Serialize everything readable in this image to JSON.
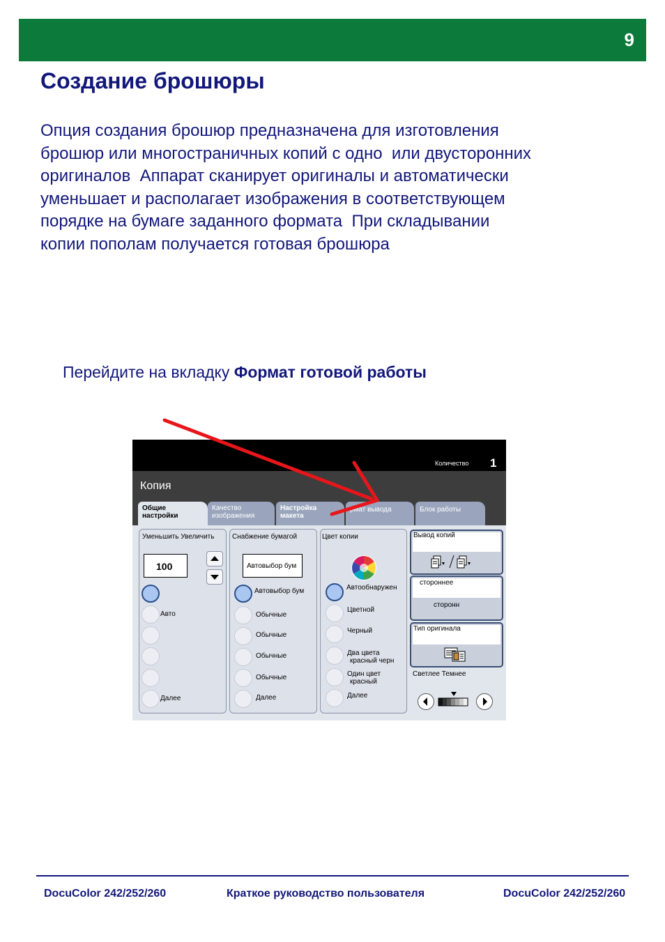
{
  "page": {
    "number": "9"
  },
  "title": "Создание брошюры",
  "intro_lines": [
    "Опция создания брошюр предназначена для изготовления",
    "брошюр или многостраничных копий с одно  или двусторонних",
    "оригиналов  Аппарат сканирует оригиналы и автоматически",
    "уменьшает и располагает изображения в соответствующем",
    "порядке на бумаге заданного формата  При складывании",
    "копии пополам получается готовая брошюра"
  ],
  "instruction": {
    "prefix": "Перейдите на вкладку ",
    "target": "Формат готовой работы"
  },
  "screen": {
    "quantity_label": "Количество",
    "quantity_value": "1",
    "title": "Копия",
    "tabs": [
      {
        "line1": "Общие",
        "line2": "настройки"
      },
      {
        "line1": "Качество",
        "line2": "изображения"
      },
      {
        "line1": "Настройка",
        "line2": "макета"
      },
      {
        "line1": "рмат вывода",
        "line2": ""
      },
      {
        "line1": "Блок работы",
        "line2": ""
      }
    ],
    "reduce_panel": {
      "label": "Уменьшить Увеличить",
      "value": "100",
      "options": [
        "Авто",
        "Далее"
      ]
    },
    "paper_panel": {
      "label": "Снабжение бумагой",
      "field": "Автовыбор бум",
      "options": [
        "Автовыбор бум",
        "Обычные",
        "Обычные",
        "Обычные",
        "Обычные",
        "Далее"
      ]
    },
    "color_panel": {
      "label": "Цвет копии",
      "options": [
        "Автообнаружен",
        "Цветной",
        "Черный",
        "Два цвета",
        "красный черн",
        "Один цвет",
        "красный",
        "Далее"
      ]
    },
    "output_panel": {
      "label": "Вывод копий"
    },
    "sides_panel": {
      "line1": "стороннее",
      "line2": "сторонн"
    },
    "original_panel": {
      "label": "Тип оригинала"
    },
    "density": {
      "label": "Светлее Темнее"
    }
  },
  "footer": {
    "left": "DocuColor 242/252/260",
    "center": "Краткое руководство пользователя",
    "right": "DocuColor 242/252/260"
  },
  "colors": {
    "header_green": "#0b7a3a",
    "text_navy": "#12177a",
    "arrow_red": "#e8161b"
  }
}
